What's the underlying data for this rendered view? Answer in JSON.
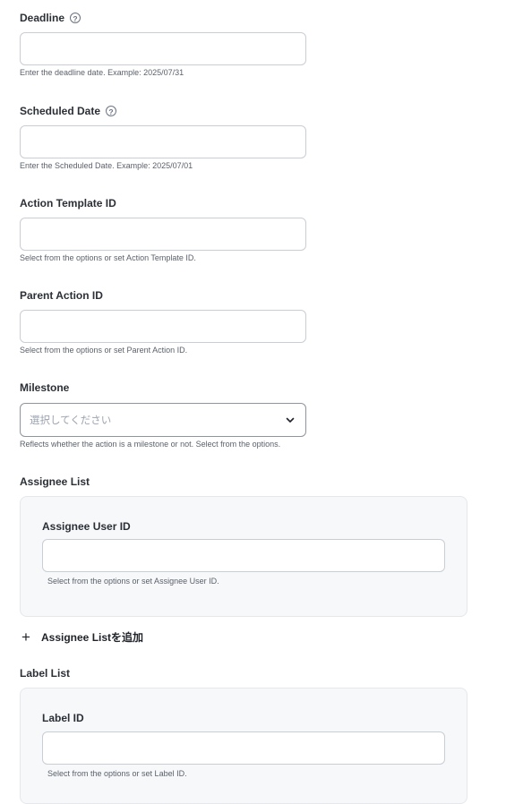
{
  "deadline": {
    "label": "Deadline",
    "help_icon": "?",
    "value": "",
    "hint": "Enter the deadline date. Example: 2025/07/31"
  },
  "scheduled_date": {
    "label": "Scheduled Date",
    "help_icon": "?",
    "value": "",
    "hint": "Enter the Scheduled Date. Example: 2025/07/01"
  },
  "action_template_id": {
    "label": "Action Template ID",
    "value": "",
    "hint": "Select from the options or set Action Template ID."
  },
  "parent_action_id": {
    "label": "Parent Action ID",
    "value": "",
    "hint": "Select from the options or set Parent Action ID."
  },
  "milestone": {
    "label": "Milestone",
    "placeholder": "選択してください",
    "hint": "Reflects whether the action is a milestone or not. Select from the options."
  },
  "assignee_list": {
    "title": "Assignee List",
    "item_label": "Assignee User ID",
    "value": "",
    "hint": "Select from the options or set Assignee User ID.",
    "add_label": "Assignee Listを追加",
    "add_icon": "+"
  },
  "label_list": {
    "title": "Label List",
    "item_label": "Label ID",
    "value": "",
    "hint": "Select from the options or set Label ID."
  }
}
